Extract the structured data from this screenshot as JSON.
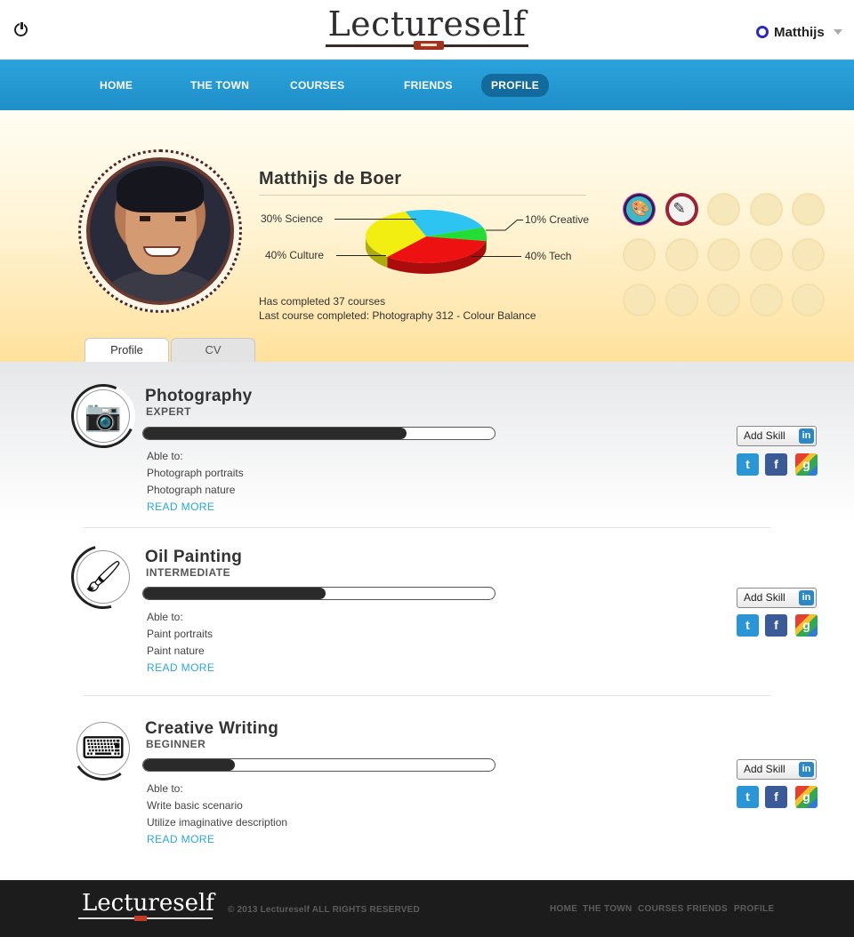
{
  "header": {
    "logo": "Lectureself",
    "user_name": "Matthijs"
  },
  "nav": {
    "items": [
      {
        "label": "HOME"
      },
      {
        "label": "THE TOWN"
      },
      {
        "label": "COURSES"
      },
      {
        "label": "FRIENDS"
      },
      {
        "label": "PROFILE",
        "active": true
      }
    ]
  },
  "profile": {
    "name": "Matthijs de Boer",
    "stat_courses": "Has completed 37 courses",
    "stat_last": "Last course completed: Photography 312 - Colour Balance",
    "tabs": [
      {
        "label": "Profile",
        "active": true
      },
      {
        "label": "CV",
        "active": false
      }
    ],
    "badges": {
      "earned": [
        "paint-palette-badge",
        "writing-badge"
      ],
      "locked_count": 13
    }
  },
  "chart_data": {
    "type": "pie",
    "title": "",
    "labels_shown": [
      "30% Science",
      "10% Creative",
      "40% Culture",
      "40% Tech"
    ],
    "slices": [
      {
        "name": "Science",
        "value": 30,
        "color": "#2ec4f2"
      },
      {
        "name": "Creative",
        "value": 10,
        "color": "#22dd33"
      },
      {
        "name": "Tech",
        "value": 40,
        "color": "#ee1111"
      },
      {
        "name": "Culture",
        "value": 40,
        "color": "#f2ee11"
      }
    ]
  },
  "skills": [
    {
      "title": "Photography",
      "level": "EXPERT",
      "progress": 0.75,
      "icon": "camera-icon",
      "able_to": "Able to:",
      "abilities": [
        "Photograph portraits",
        "Photograph nature"
      ],
      "read_more": "READ MORE",
      "add_skill": "Add Skill"
    },
    {
      "title": "Oil Painting",
      "level": "INTERMEDIATE",
      "progress": 0.52,
      "icon": "paintbrush-icon",
      "able_to": "Able to:",
      "abilities": [
        "Paint portraits",
        "Paint nature"
      ],
      "read_more": "READ MORE",
      "add_skill": "Add Skill"
    },
    {
      "title": "Creative Writing",
      "level": "BEGINNER",
      "progress": 0.26,
      "icon": "typewriter-icon",
      "able_to": "Able to:",
      "abilities": [
        "Write basic scenario",
        "Utilize imaginative description"
      ],
      "read_more": "READ MORE",
      "add_skill": "Add Skill"
    }
  ],
  "footer": {
    "logo": "Lectureself",
    "copyright": "© 2013 Lectureself  ALL RIGHTS RESERVED",
    "links": [
      "HOME",
      "THE TOWN",
      "COURSES",
      "FRIENDS",
      "PROFILE"
    ]
  },
  "colors": {
    "nav_blue": "#2ba3dc",
    "nav_active": "#136a9c",
    "link_blue": "#2aa7df",
    "footer_bg": "#1c1c1c"
  }
}
